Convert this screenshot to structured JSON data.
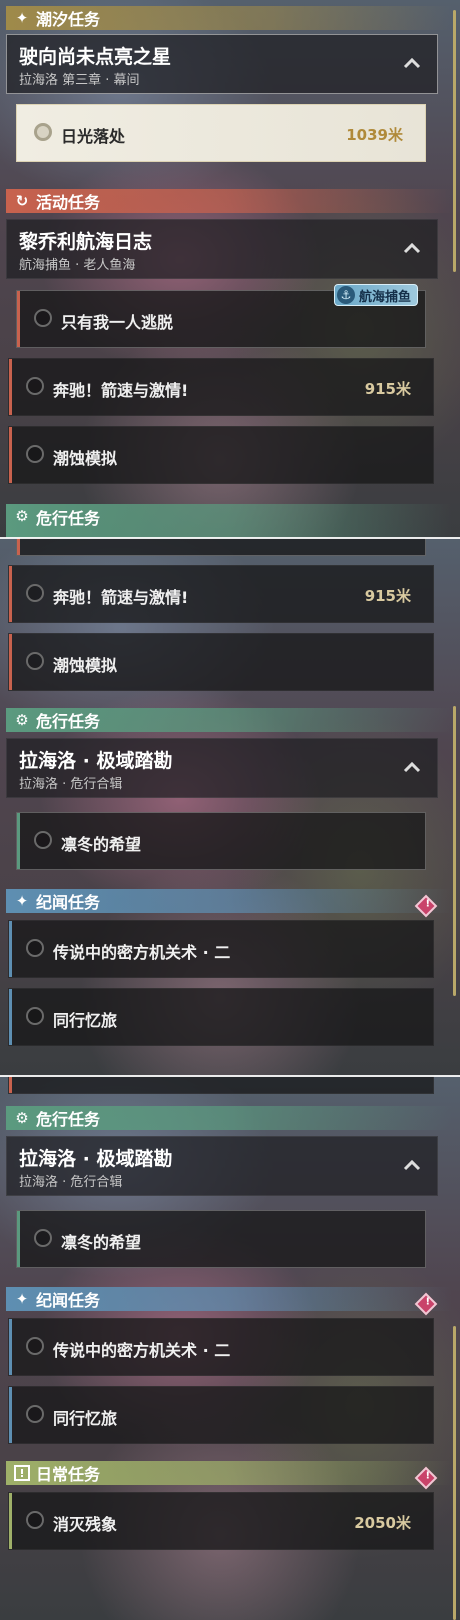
{
  "sections": {
    "tide": {
      "icon": "sparkle-icon",
      "title": "潮汐任务",
      "color": "#9f8a4a"
    },
    "event": {
      "icon": "refresh-quest-icon",
      "title": "活动任务",
      "color": "#c8624e"
    },
    "danger": {
      "icon": "gear-danger-icon",
      "title": "危行任务",
      "color": "#5b9a7f"
    },
    "chronicle": {
      "icon": "sparkle-icon",
      "title": "纪闻任务",
      "color": "#5e8fb2"
    },
    "daily": {
      "icon": "exclamation-box-icon",
      "title": "日常任务",
      "color": "#9fb069"
    }
  },
  "groups": {
    "star": {
      "title": "驶向尚未点亮之星",
      "subtitle": "拉海洛 第三章 · 幕间"
    },
    "log": {
      "title": "黎乔利航海日志",
      "subtitle": "航海捕鱼 · 老人鱼海"
    },
    "lahailuo": {
      "title": "拉海洛 · 极域踏勘",
      "subtitle": "拉海洛 · 危行合辑"
    }
  },
  "quests": {
    "sunlight": {
      "label": "日光落处",
      "distance": "1039米"
    },
    "escape": {
      "label": "只有我一人逃脱"
    },
    "gallop": {
      "label": "奔驰！箭速与激情!",
      "distance": "915米"
    },
    "erosion": {
      "label": "潮蚀模拟"
    },
    "winter": {
      "label": "凛冬的希望"
    },
    "legend": {
      "label": "传说中的密方机关术 · 二"
    },
    "companion": {
      "label": "同行忆旅"
    },
    "eliminate": {
      "label": "消灭残象",
      "distance": "2050米"
    }
  },
  "badges": {
    "fishing_tag": "航海捕鱼",
    "alert_symbol": "!"
  },
  "colors": {
    "accent_gold": "#b9a869",
    "alert_pink": "#c9436a"
  }
}
